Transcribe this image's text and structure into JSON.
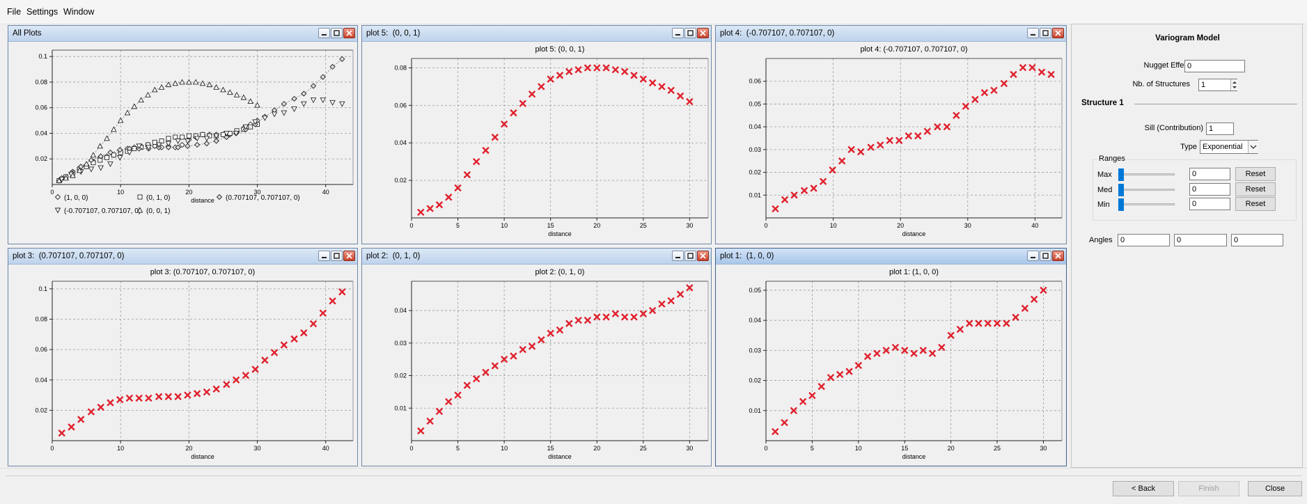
{
  "menu": {
    "file": "File",
    "settings": "Settings",
    "window": "Window"
  },
  "windows": [
    {
      "id": "all",
      "title": "All Plots",
      "active": false
    },
    {
      "id": "w5",
      "title": "plot 5:  (0, 0, 1)",
      "active": false
    },
    {
      "id": "w4",
      "title": "plot 4:  (-0.707107, 0.707107, 0)",
      "active": false
    },
    {
      "id": "w3",
      "title": "plot 3:  (0.707107, 0.707107, 0)",
      "active": false
    },
    {
      "id": "w2",
      "title": "plot 2:  (0, 1, 0)",
      "active": false
    },
    {
      "id": "w1",
      "title": "plot 1:  (1, 0, 0)",
      "active": true
    }
  ],
  "chart_data": [
    {
      "id": "all",
      "type": "scatter",
      "title": "",
      "xlabel": "distance",
      "ylabel": "",
      "xlim": [
        0,
        44
      ],
      "ylim": [
        0,
        0.105
      ],
      "xticks": [
        0,
        10,
        20,
        30,
        40
      ],
      "yticks": [
        0.02,
        0.04,
        0.06,
        0.08,
        0.1
      ],
      "grid": true,
      "legend": "bottom",
      "series": [
        {
          "name": "(1, 0, 0)",
          "marker": "diamond",
          "x": [
            1,
            2,
            3,
            4,
            5,
            6,
            7,
            8,
            9,
            10,
            11,
            12,
            13,
            14,
            15,
            16,
            17,
            18,
            19,
            20,
            21,
            22,
            23,
            24,
            25,
            26,
            27,
            28,
            29,
            30
          ],
          "y": [
            0.003,
            0.006,
            0.01,
            0.013,
            0.015,
            0.018,
            0.021,
            0.022,
            0.023,
            0.025,
            0.028,
            0.029,
            0.03,
            0.031,
            0.03,
            0.029,
            0.03,
            0.029,
            0.031,
            0.035,
            0.037,
            0.039,
            0.039,
            0.039,
            0.039,
            0.039,
            0.041,
            0.044,
            0.047,
            0.05
          ]
        },
        {
          "name": "(0, 1, 0)",
          "marker": "square",
          "x": [
            1,
            2,
            3,
            4,
            5,
            6,
            7,
            8,
            9,
            10,
            11,
            12,
            13,
            14,
            15,
            16,
            17,
            18,
            19,
            20,
            21,
            22,
            23,
            24,
            25,
            26,
            27,
            28,
            29,
            30
          ],
          "y": [
            0.003,
            0.006,
            0.009,
            0.012,
            0.014,
            0.017,
            0.019,
            0.021,
            0.023,
            0.025,
            0.026,
            0.028,
            0.029,
            0.031,
            0.033,
            0.034,
            0.036,
            0.037,
            0.037,
            0.038,
            0.038,
            0.039,
            0.038,
            0.038,
            0.039,
            0.04,
            0.042,
            0.043,
            0.045,
            0.047
          ]
        },
        {
          "name": "(0.707107, 0.707107, 0)",
          "marker": "diamond-dot",
          "x": [
            1.4,
            2.8,
            4.2,
            5.7,
            7.1,
            8.5,
            9.9,
            11.3,
            12.7,
            14.1,
            15.6,
            17,
            18.4,
            19.8,
            21.2,
            22.6,
            24,
            25.5,
            26.9,
            28.3,
            29.7,
            31.1,
            32.5,
            33.9,
            35.4,
            36.8,
            38.2,
            39.6,
            41,
            42.4
          ],
          "y": [
            0.005,
            0.009,
            0.014,
            0.019,
            0.022,
            0.025,
            0.027,
            0.028,
            0.028,
            0.028,
            0.029,
            0.029,
            0.029,
            0.03,
            0.031,
            0.032,
            0.034,
            0.037,
            0.04,
            0.043,
            0.047,
            0.053,
            0.058,
            0.063,
            0.067,
            0.071,
            0.077,
            0.084,
            0.092,
            0.098
          ]
        },
        {
          "name": "(-0.707107, 0.707107, 0)",
          "marker": "triangle-down",
          "x": [
            1.4,
            2.8,
            4.2,
            5.7,
            7.1,
            8.5,
            9.9,
            11.3,
            12.7,
            14.1,
            15.6,
            17,
            18.4,
            19.8,
            21.2,
            22.6,
            24,
            25.5,
            26.9,
            28.3,
            29.7,
            31.1,
            32.5,
            33.9,
            35.4,
            36.8,
            38.2,
            39.6,
            41,
            42.4
          ],
          "y": [
            0.004,
            0.008,
            0.01,
            0.012,
            0.013,
            0.016,
            0.021,
            0.025,
            0.03,
            0.029,
            0.031,
            0.032,
            0.034,
            0.034,
            0.036,
            0.036,
            0.038,
            0.04,
            0.04,
            0.045,
            0.049,
            0.052,
            0.055,
            0.056,
            0.059,
            0.063,
            0.066,
            0.066,
            0.064,
            0.063
          ]
        },
        {
          "name": "(0, 0, 1)",
          "marker": "triangle-up",
          "x": [
            1,
            2,
            3,
            4,
            5,
            6,
            7,
            8,
            9,
            10,
            11,
            12,
            13,
            14,
            15,
            16,
            17,
            18,
            19,
            20,
            21,
            22,
            23,
            24,
            25,
            26,
            27,
            28,
            29,
            30
          ],
          "y": [
            0.003,
            0.005,
            0.007,
            0.011,
            0.016,
            0.023,
            0.03,
            0.036,
            0.043,
            0.05,
            0.056,
            0.061,
            0.066,
            0.07,
            0.074,
            0.076,
            0.078,
            0.079,
            0.08,
            0.08,
            0.08,
            0.079,
            0.078,
            0.076,
            0.074,
            0.072,
            0.07,
            0.068,
            0.065,
            0.062
          ]
        }
      ]
    },
    {
      "id": "w5",
      "type": "scatter",
      "title": "plot 5:  (0, 0, 1)",
      "xlabel": "distance",
      "ylabel": "",
      "xlim": [
        0,
        32
      ],
      "ylim": [
        0,
        0.085
      ],
      "xticks": [
        0,
        5,
        10,
        15,
        20,
        25,
        30
      ],
      "yticks": [
        0.02,
        0.04,
        0.06,
        0.08
      ],
      "grid": true,
      "series": [
        {
          "x": [
            1,
            2,
            3,
            4,
            5,
            6,
            7,
            8,
            9,
            10,
            11,
            12,
            13,
            14,
            15,
            16,
            17,
            18,
            19,
            20,
            21,
            22,
            23,
            24,
            25,
            26,
            27,
            28,
            29,
            30
          ],
          "y": [
            0.003,
            0.005,
            0.007,
            0.011,
            0.016,
            0.023,
            0.03,
            0.036,
            0.043,
            0.05,
            0.056,
            0.061,
            0.066,
            0.07,
            0.074,
            0.076,
            0.078,
            0.079,
            0.08,
            0.08,
            0.08,
            0.079,
            0.078,
            0.076,
            0.074,
            0.072,
            0.07,
            0.068,
            0.065,
            0.062
          ]
        }
      ]
    },
    {
      "id": "w4",
      "type": "scatter",
      "title": "plot 4:  (-0.707107, 0.707107, 0)",
      "xlabel": "distance",
      "ylabel": "",
      "xlim": [
        0,
        44
      ],
      "ylim": [
        0,
        0.07
      ],
      "xticks": [
        0,
        10,
        20,
        30,
        40
      ],
      "yticks": [
        0.01,
        0.02,
        0.03,
        0.04,
        0.05,
        0.06
      ],
      "grid": true,
      "series": [
        {
          "x": [
            1.4,
            2.8,
            4.2,
            5.7,
            7.1,
            8.5,
            9.9,
            11.3,
            12.7,
            14.1,
            15.6,
            17,
            18.4,
            19.8,
            21.2,
            22.6,
            24,
            25.5,
            26.9,
            28.3,
            29.7,
            31.1,
            32.5,
            33.9,
            35.4,
            36.8,
            38.2,
            39.6,
            41,
            42.4
          ],
          "y": [
            0.004,
            0.008,
            0.01,
            0.012,
            0.013,
            0.016,
            0.021,
            0.025,
            0.03,
            0.029,
            0.031,
            0.032,
            0.034,
            0.034,
            0.036,
            0.036,
            0.038,
            0.04,
            0.04,
            0.045,
            0.049,
            0.052,
            0.055,
            0.056,
            0.059,
            0.063,
            0.066,
            0.066,
            0.064,
            0.063
          ]
        }
      ]
    },
    {
      "id": "w3",
      "type": "scatter",
      "title": "plot 3:  (0.707107, 0.707107, 0)",
      "xlabel": "distance",
      "ylabel": "",
      "xlim": [
        0,
        44
      ],
      "ylim": [
        0,
        0.105
      ],
      "xticks": [
        0,
        10,
        20,
        30,
        40
      ],
      "yticks": [
        0.02,
        0.04,
        0.06,
        0.08,
        0.1
      ],
      "grid": true,
      "series": [
        {
          "x": [
            1.4,
            2.8,
            4.2,
            5.7,
            7.1,
            8.5,
            9.9,
            11.3,
            12.7,
            14.1,
            15.6,
            17,
            18.4,
            19.8,
            21.2,
            22.6,
            24,
            25.5,
            26.9,
            28.3,
            29.7,
            31.1,
            32.5,
            33.9,
            35.4,
            36.8,
            38.2,
            39.6,
            41,
            42.4
          ],
          "y": [
            0.005,
            0.009,
            0.014,
            0.019,
            0.022,
            0.025,
            0.027,
            0.028,
            0.028,
            0.028,
            0.029,
            0.029,
            0.029,
            0.03,
            0.031,
            0.032,
            0.034,
            0.037,
            0.04,
            0.043,
            0.047,
            0.053,
            0.058,
            0.063,
            0.067,
            0.071,
            0.077,
            0.084,
            0.092,
            0.098
          ]
        }
      ]
    },
    {
      "id": "w2",
      "type": "scatter",
      "title": "plot 2:  (0, 1, 0)",
      "xlabel": "distance",
      "ylabel": "",
      "xlim": [
        0,
        32
      ],
      "ylim": [
        0,
        0.049
      ],
      "xticks": [
        0,
        5,
        10,
        15,
        20,
        25,
        30
      ],
      "yticks": [
        0.01,
        0.02,
        0.03,
        0.04
      ],
      "grid": true,
      "series": [
        {
          "x": [
            1,
            2,
            3,
            4,
            5,
            6,
            7,
            8,
            9,
            10,
            11,
            12,
            13,
            14,
            15,
            16,
            17,
            18,
            19,
            20,
            21,
            22,
            23,
            24,
            25,
            26,
            27,
            28,
            29,
            30
          ],
          "y": [
            0.003,
            0.006,
            0.009,
            0.012,
            0.014,
            0.017,
            0.019,
            0.021,
            0.023,
            0.025,
            0.026,
            0.028,
            0.029,
            0.031,
            0.033,
            0.034,
            0.036,
            0.037,
            0.037,
            0.038,
            0.038,
            0.039,
            0.038,
            0.038,
            0.039,
            0.04,
            0.042,
            0.043,
            0.045,
            0.047
          ]
        }
      ]
    },
    {
      "id": "w1",
      "type": "scatter",
      "title": "plot 1:  (1, 0, 0)",
      "xlabel": "distance",
      "ylabel": "",
      "xlim": [
        0,
        32
      ],
      "ylim": [
        0,
        0.053
      ],
      "xticks": [
        0,
        5,
        10,
        15,
        20,
        25,
        30
      ],
      "yticks": [
        0.01,
        0.02,
        0.03,
        0.04,
        0.05
      ],
      "grid": true,
      "series": [
        {
          "x": [
            1,
            2,
            3,
            4,
            5,
            6,
            7,
            8,
            9,
            10,
            11,
            12,
            13,
            14,
            15,
            16,
            17,
            18,
            19,
            20,
            21,
            22,
            23,
            24,
            25,
            26,
            27,
            28,
            29,
            30
          ],
          "y": [
            0.003,
            0.006,
            0.01,
            0.013,
            0.015,
            0.018,
            0.021,
            0.022,
            0.023,
            0.025,
            0.028,
            0.029,
            0.03,
            0.031,
            0.03,
            0.029,
            0.03,
            0.029,
            0.031,
            0.035,
            0.037,
            0.039,
            0.039,
            0.039,
            0.039,
            0.039,
            0.041,
            0.044,
            0.047,
            0.05
          ]
        }
      ]
    }
  ],
  "marker_color": "#e0202c",
  "panel": {
    "title": "Variogram Model",
    "nugget_label": "Nugget Effect",
    "nugget_value": "0",
    "nstruct_label": "Nb. of Structures",
    "nstruct_value": "1",
    "structure_label": "Structure 1",
    "sill_label": "Sill (Contribution)",
    "sill_value": "1",
    "type_label": "Type",
    "type_value": "Exponential",
    "ranges_label": "Ranges",
    "ranges": [
      {
        "label": "Max",
        "value": "0",
        "reset": "Reset"
      },
      {
        "label": "Med",
        "value": "0",
        "reset": "Reset"
      },
      {
        "label": "Min",
        "value": "0",
        "reset": "Reset"
      }
    ],
    "angles_label": "Angles",
    "angles": [
      "0",
      "0",
      "0"
    ]
  },
  "footer": {
    "back": "< Back",
    "finish": "Finish",
    "close": "Close"
  }
}
